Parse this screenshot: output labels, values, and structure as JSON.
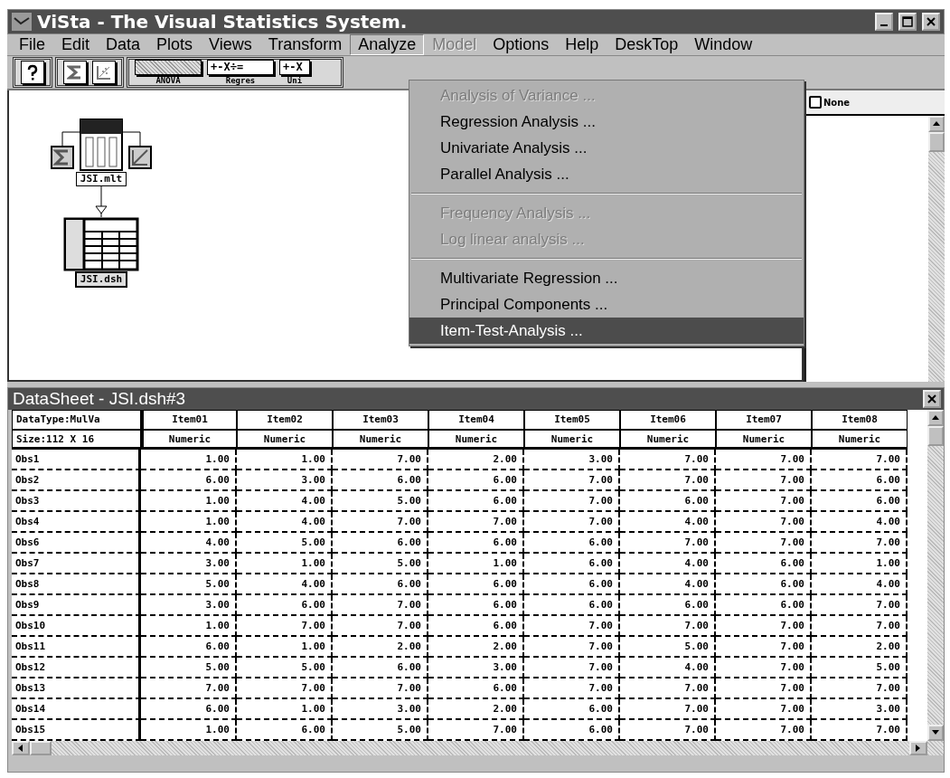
{
  "window": {
    "title": "ViSta - The Visual Statistics System."
  },
  "menu_bar": [
    {
      "label": "File",
      "selected": false,
      "disabled": false
    },
    {
      "label": "Edit",
      "selected": false,
      "disabled": false
    },
    {
      "label": "Data",
      "selected": false,
      "disabled": false
    },
    {
      "label": "Plots",
      "selected": false,
      "disabled": false
    },
    {
      "label": "Views",
      "selected": false,
      "disabled": false
    },
    {
      "label": "Transform",
      "selected": false,
      "disabled": false
    },
    {
      "label": "Analyze",
      "selected": true,
      "disabled": false
    },
    {
      "label": "Model",
      "selected": false,
      "disabled": true
    },
    {
      "label": "Options",
      "selected": false,
      "disabled": false
    },
    {
      "label": "Help",
      "selected": false,
      "disabled": false
    },
    {
      "label": "DeskTop",
      "selected": false,
      "disabled": false
    },
    {
      "label": "Window",
      "selected": false,
      "disabled": false
    }
  ],
  "toolbar": {
    "tools": [
      {
        "kind": "pattern",
        "label": "ANOVA"
      },
      {
        "kind": "symbols",
        "symbol": "+-X÷=",
        "label": "Regres"
      },
      {
        "kind": "symbols",
        "symbol": "+-X",
        "label": "Uni"
      }
    ]
  },
  "desktop": {
    "nodes": [
      {
        "kind": "model",
        "label": "JSI.mlt"
      },
      {
        "kind": "datasheet",
        "label": "JSI.dsh"
      }
    ]
  },
  "side_panel": {
    "checkbox": {
      "label": "None",
      "checked": false
    }
  },
  "analyze_menu": {
    "sections": [
      {
        "items": [
          {
            "label": "Analysis of Variance ...",
            "disabled": true,
            "selected": false
          },
          {
            "label": "Regression Analysis ...",
            "disabled": false,
            "selected": false
          },
          {
            "label": "Univariate Analysis ...",
            "disabled": false,
            "selected": false
          },
          {
            "label": "Parallel Analysis ...",
            "disabled": false,
            "selected": false
          }
        ]
      },
      {
        "items": [
          {
            "label": "Frequency Analysis ...",
            "disabled": true,
            "selected": false
          },
          {
            "label": "Log linear analysis ...",
            "disabled": true,
            "selected": false
          }
        ]
      },
      {
        "items": [
          {
            "label": "Multivariate Regression ...",
            "disabled": false,
            "selected": false
          },
          {
            "label": "Principal Components ...",
            "disabled": false,
            "selected": false
          },
          {
            "label": "Item-Test-Analysis ...",
            "disabled": false,
            "selected": true
          }
        ]
      }
    ]
  },
  "datasheet": {
    "title": "DataSheet - JSI.dsh#3",
    "info": [
      "DataType:MulVa",
      "Size:112 X 16"
    ],
    "columns": [
      {
        "name": "Item01",
        "type": "Numeric"
      },
      {
        "name": "Item02",
        "type": "Numeric"
      },
      {
        "name": "Item03",
        "type": "Numeric"
      },
      {
        "name": "Item04",
        "type": "Numeric"
      },
      {
        "name": "Item05",
        "type": "Numeric"
      },
      {
        "name": "Item06",
        "type": "Numeric"
      },
      {
        "name": "Item07",
        "type": "Numeric"
      },
      {
        "name": "Item08",
        "type": "Numeric"
      }
    ],
    "rows": [
      {
        "label": "Obs1",
        "values": [
          "1.00",
          "1.00",
          "7.00",
          "2.00",
          "3.00",
          "7.00",
          "7.00",
          "7.00"
        ]
      },
      {
        "label": "Obs2",
        "values": [
          "6.00",
          "3.00",
          "6.00",
          "6.00",
          "7.00",
          "7.00",
          "7.00",
          "6.00"
        ]
      },
      {
        "label": "Obs3",
        "values": [
          "1.00",
          "4.00",
          "5.00",
          "6.00",
          "7.00",
          "6.00",
          "7.00",
          "6.00"
        ]
      },
      {
        "label": "Obs4",
        "values": [
          "1.00",
          "4.00",
          "7.00",
          "7.00",
          "7.00",
          "4.00",
          "7.00",
          "4.00"
        ]
      },
      {
        "label": "Obs6",
        "values": [
          "4.00",
          "5.00",
          "6.00",
          "6.00",
          "6.00",
          "7.00",
          "7.00",
          "7.00"
        ]
      },
      {
        "label": "Obs7",
        "values": [
          "3.00",
          "1.00",
          "5.00",
          "1.00",
          "6.00",
          "4.00",
          "6.00",
          "1.00"
        ]
      },
      {
        "label": "Obs8",
        "values": [
          "5.00",
          "4.00",
          "6.00",
          "6.00",
          "6.00",
          "4.00",
          "6.00",
          "4.00"
        ]
      },
      {
        "label": "Obs9",
        "values": [
          "3.00",
          "6.00",
          "7.00",
          "6.00",
          "6.00",
          "6.00",
          "6.00",
          "7.00"
        ]
      },
      {
        "label": "Obs10",
        "values": [
          "1.00",
          "7.00",
          "7.00",
          "6.00",
          "7.00",
          "7.00",
          "7.00",
          "7.00"
        ]
      },
      {
        "label": "Obs11",
        "values": [
          "6.00",
          "1.00",
          "2.00",
          "2.00",
          "7.00",
          "5.00",
          "7.00",
          "2.00"
        ]
      },
      {
        "label": "Obs12",
        "values": [
          "5.00",
          "5.00",
          "6.00",
          "3.00",
          "7.00",
          "4.00",
          "7.00",
          "5.00"
        ]
      },
      {
        "label": "Obs13",
        "values": [
          "7.00",
          "7.00",
          "7.00",
          "6.00",
          "7.00",
          "7.00",
          "7.00",
          "7.00"
        ]
      },
      {
        "label": "Obs14",
        "values": [
          "6.00",
          "1.00",
          "3.00",
          "2.00",
          "6.00",
          "7.00",
          "7.00",
          "3.00"
        ]
      },
      {
        "label": "Obs15",
        "values": [
          "1.00",
          "6.00",
          "5.00",
          "7.00",
          "6.00",
          "7.00",
          "7.00",
          "7.00"
        ]
      }
    ]
  }
}
